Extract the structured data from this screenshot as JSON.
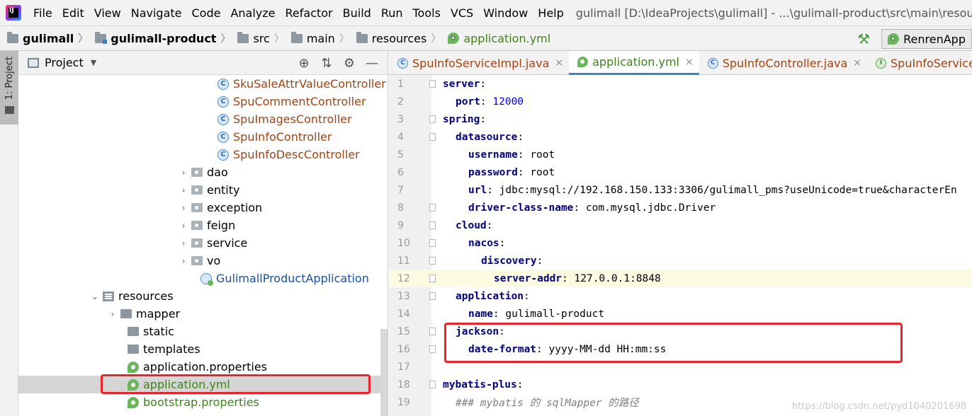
{
  "menubar": {
    "items": [
      "File",
      "Edit",
      "View",
      "Navigate",
      "Code",
      "Analyze",
      "Refactor",
      "Build",
      "Run",
      "Tools",
      "VCS",
      "Window",
      "Help"
    ],
    "window_title": "gulimall [D:\\IdeaProjects\\gulimall] - ...\\gulimall-product\\src\\main\\resources\\appl"
  },
  "breadcrumb": {
    "items": [
      "gulimall",
      "gulimall-product",
      "src",
      "main",
      "resources",
      "application.yml"
    ],
    "run_config": "RenrenApp"
  },
  "tool_stripe": {
    "label": "1: Project"
  },
  "project_panel": {
    "title": "Project",
    "tree": [
      {
        "text": "SkuSaleAttrValueController",
        "kind": "class",
        "arrow": ""
      },
      {
        "text": "SpuCommentController",
        "kind": "class",
        "arrow": ""
      },
      {
        "text": "SpuImagesController",
        "kind": "class",
        "arrow": ""
      },
      {
        "text": "SpuInfoController",
        "kind": "class",
        "arrow": ""
      },
      {
        "text": "SpuInfoDescController",
        "kind": "class",
        "arrow": ""
      },
      {
        "text": "dao",
        "kind": "package",
        "arrow": "›"
      },
      {
        "text": "entity",
        "kind": "package",
        "arrow": "›"
      },
      {
        "text": "exception",
        "kind": "package",
        "arrow": "›"
      },
      {
        "text": "feign",
        "kind": "package",
        "arrow": "›"
      },
      {
        "text": "service",
        "kind": "package",
        "arrow": "›"
      },
      {
        "text": "vo",
        "kind": "package",
        "arrow": "›"
      },
      {
        "text": "GulimallProductApplication",
        "kind": "app",
        "arrow": ""
      },
      {
        "text": "resources",
        "kind": "resources",
        "arrow": "⌄"
      },
      {
        "text": "mapper",
        "kind": "dir",
        "arrow": "›"
      },
      {
        "text": "static",
        "kind": "dir",
        "arrow": ""
      },
      {
        "text": "templates",
        "kind": "dir",
        "arrow": ""
      },
      {
        "text": "application.properties",
        "kind": "spring",
        "arrow": ""
      },
      {
        "text": "application.yml",
        "kind": "spring",
        "arrow": ""
      },
      {
        "text": "bootstrap.properties",
        "kind": "spring",
        "arrow": ""
      }
    ]
  },
  "editor": {
    "tabs": [
      {
        "label": "SpuInfoServiceImpl.java",
        "icon": "C"
      },
      {
        "label": "application.yml",
        "icon": "leaf"
      },
      {
        "label": "SpuInfoController.java",
        "icon": "C"
      },
      {
        "label": "SpuInfoService.java",
        "icon": "I"
      }
    ],
    "close_glyph": "×",
    "lines": [
      {
        "n": "1",
        "key": "server",
        "sep": ":",
        "val": ""
      },
      {
        "n": "2",
        "key": "port",
        "sep": ": ",
        "val": "12000"
      },
      {
        "n": "3",
        "key": "spring",
        "sep": ":",
        "val": ""
      },
      {
        "n": "4",
        "key": "datasource",
        "sep": ":",
        "val": ""
      },
      {
        "n": "5",
        "key": "username",
        "sep": ": ",
        "val": "root"
      },
      {
        "n": "6",
        "key": "password",
        "sep": ": ",
        "val": "root"
      },
      {
        "n": "7",
        "key": "url",
        "sep": ": ",
        "val": "jdbc:mysql://192.168.150.133:3306/gulimall_pms?useUnicode=true&characterEn"
      },
      {
        "n": "8",
        "key": "driver-class-name",
        "sep": ": ",
        "val": "com.mysql.jdbc.Driver"
      },
      {
        "n": "9",
        "key": "cloud",
        "sep": ":",
        "val": ""
      },
      {
        "n": "10",
        "key": "nacos",
        "sep": ":",
        "val": ""
      },
      {
        "n": "11",
        "key": "discovery",
        "sep": ":",
        "val": ""
      },
      {
        "n": "12",
        "key": "server-addr",
        "sep": ": ",
        "val": "127.0.0.1:8848"
      },
      {
        "n": "13",
        "key": "application",
        "sep": ":",
        "val": ""
      },
      {
        "n": "14",
        "key": "name",
        "sep": ": ",
        "val": "gulimall-product"
      },
      {
        "n": "15",
        "key": "jackson",
        "sep": ":",
        "val": ""
      },
      {
        "n": "16",
        "key": "date-format",
        "sep": ": ",
        "val": "yyyy-MM-dd HH:mm:ss"
      },
      {
        "n": "17",
        "key": "",
        "sep": "",
        "val": ""
      },
      {
        "n": "18",
        "key": "mybatis-plus",
        "sep": ":",
        "val": ""
      },
      {
        "n": "19",
        "key": "",
        "sep": "",
        "val": "### mybatis 的 sqlMapper 的路径"
      }
    ]
  },
  "watermark": "https://blog.csdn.net/pyd1040201698",
  "colors": {
    "highlight_box": "#e8242c",
    "yaml_key": "#000080",
    "class_text": "#a24311",
    "active_tab_underline": "#4083c9"
  }
}
